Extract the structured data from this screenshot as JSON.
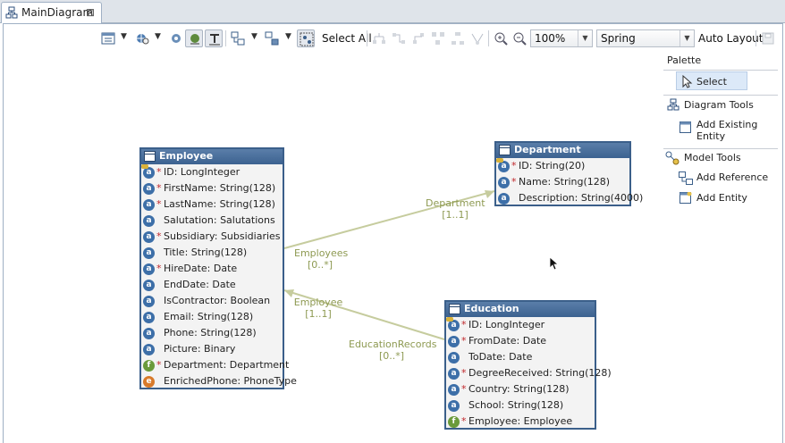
{
  "tab": {
    "label": "MainDiagram",
    "close": "⊠"
  },
  "toolbar": {
    "select_all": "Select All",
    "zoom": "100%",
    "layout_algorithm": "Spring",
    "auto_layout": "Auto Layout"
  },
  "palette": {
    "title": "Palette",
    "select": "Select",
    "diagram_tools": "Diagram Tools",
    "add_existing_entity": "Add Existing Entity",
    "model_tools": "Model Tools",
    "add_reference": "Add Reference",
    "add_entity": "Add Entity"
  },
  "entities": {
    "employee": {
      "name": "Employee",
      "attrs": [
        {
          "text": "ID: LongInteger",
          "req": "*",
          "icon": "key"
        },
        {
          "text": "FirstName: String(128)",
          "req": "*",
          "icon": "a"
        },
        {
          "text": "LastName: String(128)",
          "req": "*",
          "icon": "a"
        },
        {
          "text": "Salutation: Salutations",
          "req": "",
          "icon": "a"
        },
        {
          "text": "Subsidiary: Subsidiaries",
          "req": "*",
          "icon": "a"
        },
        {
          "text": "Title: String(128)",
          "req": "",
          "icon": "a"
        },
        {
          "text": "HireDate: Date",
          "req": "*",
          "icon": "a"
        },
        {
          "text": "EndDate: Date",
          "req": "",
          "icon": "a"
        },
        {
          "text": "IsContractor: Boolean",
          "req": "",
          "icon": "a"
        },
        {
          "text": "Email: String(128)",
          "req": "",
          "icon": "a"
        },
        {
          "text": "Phone: String(128)",
          "req": "",
          "icon": "a"
        },
        {
          "text": "Picture: Binary",
          "req": "",
          "icon": "a"
        },
        {
          "text": "Department: Department",
          "req": "*",
          "icon": "f"
        },
        {
          "text": "EnrichedPhone: PhoneType",
          "req": "",
          "icon": "e"
        }
      ]
    },
    "department": {
      "name": "Department",
      "attrs": [
        {
          "text": "ID: String(20)",
          "req": "*",
          "icon": "key"
        },
        {
          "text": "Name: String(128)",
          "req": "*",
          "icon": "a"
        },
        {
          "text": "Description: String(4000)",
          "req": "",
          "icon": "a"
        }
      ]
    },
    "education": {
      "name": "Education",
      "attrs": [
        {
          "text": "ID: LongInteger",
          "req": "*",
          "icon": "key"
        },
        {
          "text": "FromDate: Date",
          "req": "*",
          "icon": "a"
        },
        {
          "text": "ToDate: Date",
          "req": "",
          "icon": "a"
        },
        {
          "text": "DegreeReceived: String(128)",
          "req": "*",
          "icon": "a"
        },
        {
          "text": "Country: String(128)",
          "req": "*",
          "icon": "a"
        },
        {
          "text": "School: String(128)",
          "req": "",
          "icon": "a"
        },
        {
          "text": "Employee: Employee",
          "req": "*",
          "icon": "f"
        }
      ]
    }
  },
  "connections": {
    "emp_dept_src": {
      "name": "Employees",
      "mult": "[0..*]"
    },
    "emp_dept_dst": {
      "name": "Department",
      "mult": "[1..1]"
    },
    "edu_emp_src": {
      "name": "EducationRecords",
      "mult": "[0..*]"
    },
    "edu_emp_dst": {
      "name": "Employee",
      "mult": "[1..1]"
    }
  },
  "icon_letters": {
    "a": "a",
    "f": "f",
    "e": "e",
    "key": "a"
  }
}
